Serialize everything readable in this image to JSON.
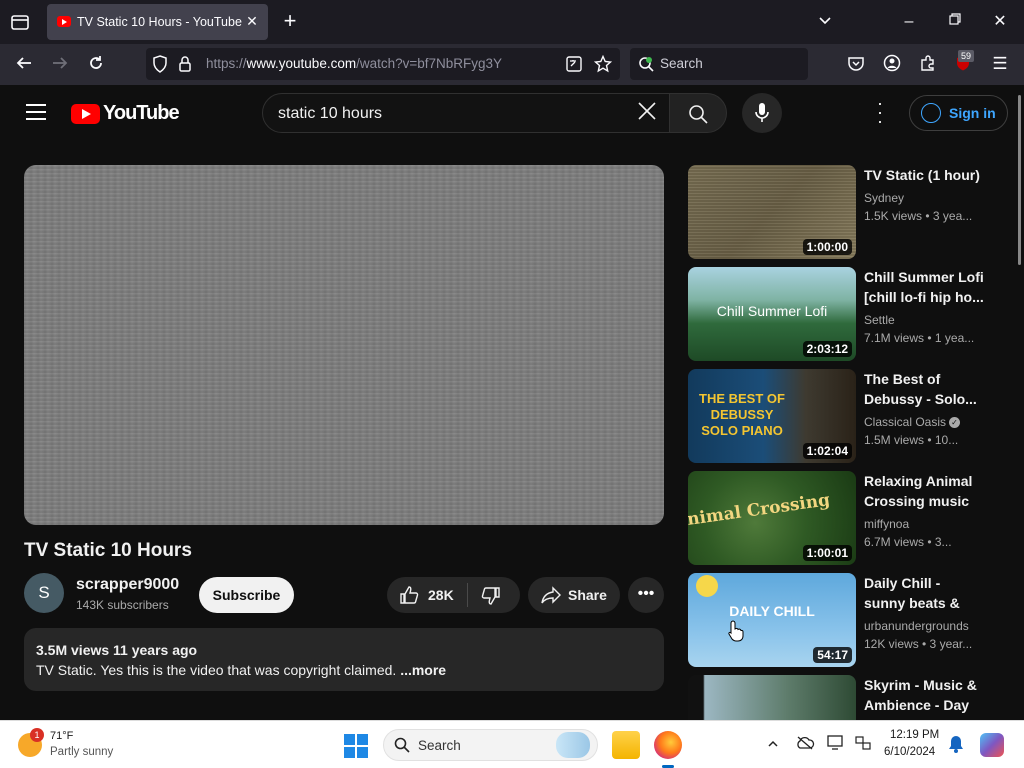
{
  "browser": {
    "tab_title": "TV Static 10 Hours - YouTube",
    "url_prefix": "https://",
    "url_domain": "www.youtube.com",
    "url_path": "/watch?v=bf7NbRFyg3Y",
    "search_placeholder": "Search",
    "extension_badge": "59"
  },
  "yt": {
    "logo_text": "YouTube",
    "search_value": "static 10 hours",
    "signin_label": "Sign in"
  },
  "video": {
    "title": "TV Static 10 Hours",
    "channel_initial": "S",
    "channel_name": "scrapper9000",
    "subscribers": "143K subscribers",
    "subscribe_label": "Subscribe",
    "likes": "28K",
    "share_label": "Share",
    "meta": "3.5M views  11 years ago",
    "description": "TV Static. Yes this is the video that was copyright claimed. ",
    "more_label": "...more"
  },
  "recommendations": [
    {
      "title": "TV Static (1 hour)",
      "channel": "Sydney",
      "stats": "1.5K views  • 3 yea...",
      "duration": "1:00:00",
      "thumb_text": ""
    },
    {
      "title": "Chill Summer Lofi [chill lo-fi hip ho...",
      "channel": "Settle",
      "stats": "7.1M views  • 1 yea...",
      "duration": "2:03:12",
      "thumb_text": "Chill Summer Lofi"
    },
    {
      "title": "The Best of Debussy - Solo...",
      "channel": "Classical Oasis",
      "stats": "1.5M views  • 10...",
      "duration": "1:02:04",
      "thumb_text": "THE BEST OF DEBUSSY SOLO PIANO"
    },
    {
      "title": "Relaxing Animal Crossing music ...",
      "channel": "miffynoa",
      "stats": "6.7M views  • 3...",
      "duration": "1:00:01",
      "thumb_text": "Animal Crossing"
    },
    {
      "title": "Daily Chill - sunny beats & jazz...",
      "channel": "urbanundergrounds",
      "stats": "12K views  • 3 year...",
      "duration": "54:17",
      "thumb_text": "DAILY CHILL"
    },
    {
      "title": "Skyrim - Music & Ambience - Day",
      "channel": "",
      "stats": "",
      "duration": "",
      "thumb_text": ""
    }
  ],
  "taskbar": {
    "weather_badge": "1",
    "temperature": "71°F",
    "weather": "Partly sunny",
    "search_label": "Search",
    "time": "12:19 PM",
    "date": "6/10/2024"
  },
  "colors": {
    "youtube_red": "#ff0000",
    "signin_blue": "#3ea6ff",
    "page_bg": "#0f0f0f"
  }
}
